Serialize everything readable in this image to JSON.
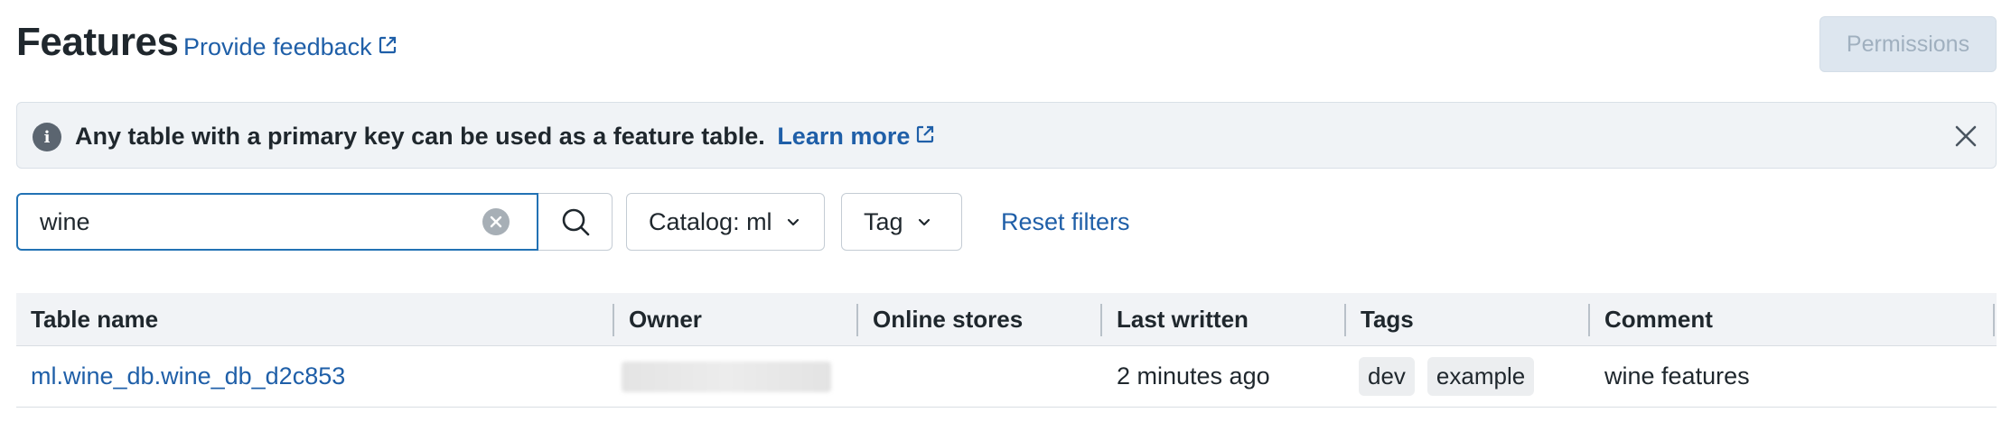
{
  "header": {
    "title": "Features",
    "feedback_label": "Provide feedback",
    "permissions_label": "Permissions"
  },
  "banner": {
    "message": "Any table with a primary key can be used as a feature table.",
    "link_label": "Learn more"
  },
  "filters": {
    "search_value": "wine",
    "catalog_label": "Catalog: ml",
    "tag_label": "Tag",
    "reset_label": "Reset filters"
  },
  "table": {
    "columns": [
      "Table name",
      "Owner",
      "Online stores",
      "Last written",
      "Tags",
      "Comment"
    ],
    "rows": [
      {
        "table_name": "ml.wine_db.wine_db_d2c853",
        "owner": "",
        "online_stores": "",
        "last_written": "2 minutes ago",
        "tags": [
          "dev",
          "example"
        ],
        "comment": "wine features"
      }
    ]
  },
  "colors": {
    "link": "#1f5fa8",
    "focus_border": "#2272b4",
    "banner_bg": "#f0f3f6",
    "header_bg": "#f1f3f6"
  }
}
